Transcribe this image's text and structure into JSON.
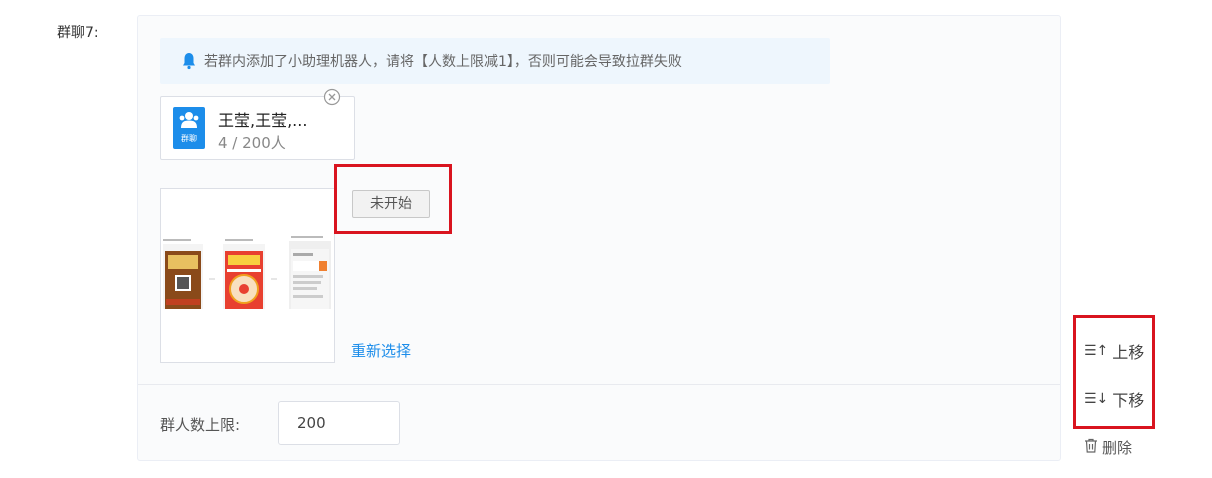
{
  "group": {
    "label": "群聊7:",
    "notice": "若群内添加了小助理机器人，请将【人数上限减1】，否则可能会导致拉群失败",
    "chip": {
      "name": "王莹,王莹,...",
      "count": "4 / 200人",
      "tag": "群聊",
      "icon": "group-users-icon"
    },
    "status_label": "未开始",
    "reselect_label": "重新选择",
    "limit_label": "群人数上限:",
    "limit_value": "200"
  },
  "actions": {
    "move_up": "上移",
    "move_down": "下移",
    "delete": "删除"
  },
  "colors": {
    "accent": "#1c8dea",
    "highlight": "#d9141f",
    "notice_bg": "#eef6fd"
  }
}
